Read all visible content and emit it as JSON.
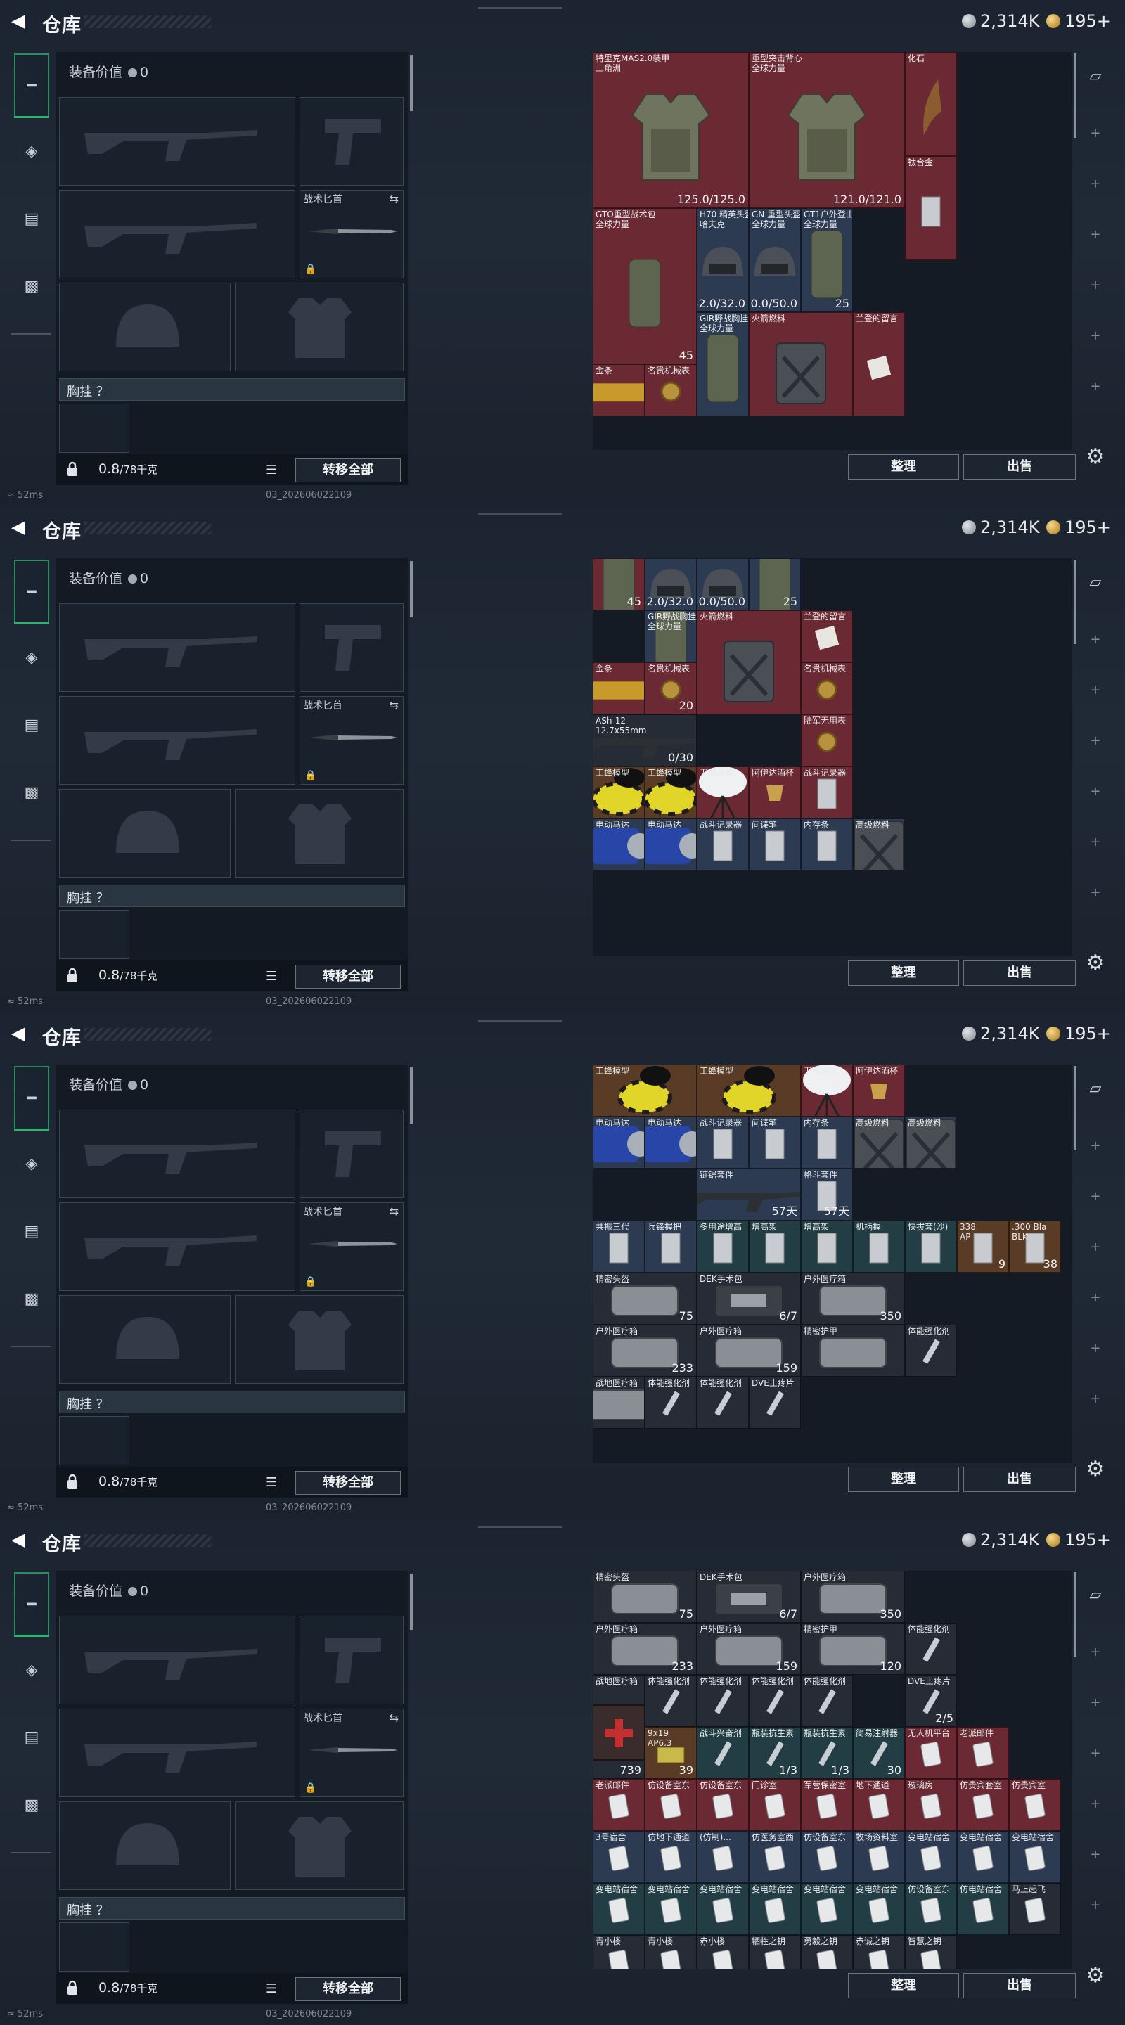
{
  "header": {
    "title": "仓库",
    "silver": "2,314K",
    "gold": "195+"
  },
  "loadout": {
    "equipment_value_label": "装备价值",
    "equipment_value": "0",
    "knife_label": "战术匕首",
    "chest_label": "胸挂 ？",
    "weight": "0.8",
    "weight_cap": "/78千克",
    "transfer_all": "转移全部"
  },
  "status": {
    "ping": "52ms",
    "build": "03_202606022109"
  },
  "stash": {
    "sort_label": "整理",
    "sell_label": "出售"
  },
  "frames": [
    {
      "items": [
        {
          "name": "特里克MAS2.0装甲",
          "sub": "三角洲",
          "value": "125.0/125.0",
          "color": "red",
          "art": "vest"
        },
        {
          "name": "重型突击背心",
          "sub": "全球力量",
          "value": "121.0/121.0",
          "color": "red",
          "art": "vest"
        },
        {
          "name": "化石",
          "sub": "",
          "value": "",
          "color": "red",
          "art": "claw"
        },
        {
          "name": "钛合金",
          "sub": "",
          "value": "",
          "color": "red",
          "art": "bar"
        },
        {
          "name": "GTO重型战术包",
          "sub": "全球力量",
          "value": "45",
          "color": "red",
          "art": "pack"
        },
        {
          "name": "H70 精英头盔",
          "sub": "哈夫克",
          "value": "32.0/32.0",
          "color": "blue",
          "art": "helmet"
        },
        {
          "name": "GN 重型头盔",
          "sub": "全球力量",
          "value": "50.0/50.0",
          "color": "blue",
          "art": "helmet"
        },
        {
          "name": "GT1户外登山包",
          "sub": "全球力量",
          "value": "25",
          "color": "blue",
          "art": "pack"
        },
        {
          "name": "GIR野战胸挂",
          "sub": "全球力量",
          "value": "",
          "color": "blue",
          "art": "pack"
        },
        {
          "name": "火箭燃料",
          "sub": "",
          "value": "",
          "color": "red",
          "art": "can"
        },
        {
          "name": "兰登的留言",
          "sub": "",
          "value": "",
          "color": "red",
          "art": "note"
        },
        {
          "name": "金条",
          "sub": "",
          "value": "",
          "color": "red",
          "art": "gold"
        },
        {
          "name": "名贵机械表",
          "sub": "",
          "value": "",
          "color": "red",
          "art": "watch"
        }
      ]
    },
    {
      "items": [
        {
          "name": "",
          "sub": "",
          "value": "45",
          "color": "red",
          "art": "pack"
        },
        {
          "name": "",
          "sub": "",
          "value": "32.0/32.0",
          "color": "blue",
          "art": "helmet"
        },
        {
          "name": "",
          "sub": "",
          "value": "50.0/50.0",
          "color": "blue",
          "art": "helmet"
        },
        {
          "name": "",
          "sub": "",
          "value": "25",
          "color": "blue",
          "art": "pack"
        },
        {
          "name": "GIR野战胸挂",
          "sub": "全球力量",
          "value": "",
          "color": "blue",
          "art": "pack"
        },
        {
          "name": "火箭燃料",
          "sub": "",
          "value": "",
          "color": "red",
          "art": "can"
        },
        {
          "name": "兰登的留言",
          "sub": "",
          "value": "",
          "color": "red",
          "art": "note"
        },
        {
          "name": "金条",
          "sub": "",
          "value": "",
          "color": "red",
          "art": "gold"
        },
        {
          "name": "名贵机械表",
          "sub": "",
          "value": "20",
          "color": "red",
          "art": "watch"
        },
        {
          "name": "ASh-12",
          "sub": "12.7x55mm",
          "value": "0/30",
          "color": "dark",
          "art": "rifle"
        },
        {
          "name": "名贵机械表",
          "sub": "",
          "value": "",
          "color": "red",
          "art": "watch"
        },
        {
          "name": "陆军无用表",
          "sub": "",
          "value": "",
          "color": "red",
          "art": "watch"
        },
        {
          "name": "工蜂模型",
          "sub": "",
          "value": "",
          "color": "brown",
          "art": "bee"
        },
        {
          "name": "工蜂模型",
          "sub": "",
          "value": "",
          "color": "brown",
          "art": "bee"
        },
        {
          "name": "卫星通信",
          "sub": "",
          "value": "",
          "color": "red",
          "art": "dish"
        },
        {
          "name": "阿伊达酒杯",
          "sub": "",
          "value": "",
          "color": "red",
          "art": "cup"
        },
        {
          "name": "战斗记录器",
          "sub": "",
          "value": "",
          "color": "red",
          "art": "bar"
        },
        {
          "name": "电动马达",
          "sub": "",
          "value": "",
          "color": "blue",
          "art": "motor"
        },
        {
          "name": "电动马达",
          "sub": "",
          "value": "",
          "color": "blue",
          "art": "motor"
        },
        {
          "name": "战斗记录器",
          "sub": "",
          "value": "",
          "color": "blue",
          "art": "bar"
        },
        {
          "name": "间谍笔",
          "sub": "",
          "value": "",
          "color": "blue",
          "art": "bar"
        },
        {
          "name": "内存条",
          "sub": "",
          "value": "",
          "color": "blue",
          "art": "bar"
        },
        {
          "name": "高级燃料",
          "sub": "",
          "value": "",
          "color": "blue",
          "art": "can"
        }
      ]
    },
    {
      "items": [
        {
          "name": "工蜂模型",
          "sub": "",
          "value": "",
          "color": "brown",
          "art": "bee"
        },
        {
          "name": "工蜂模型",
          "sub": "",
          "value": "",
          "color": "brown",
          "art": "bee"
        },
        {
          "name": "卫星通信",
          "sub": "",
          "value": "",
          "color": "red",
          "art": "dish"
        },
        {
          "name": "阿伊达酒杯",
          "sub": "",
          "value": "",
          "color": "red",
          "art": "cup"
        },
        {
          "name": "战斗记录器",
          "sub": "",
          "value": "",
          "color": "red",
          "art": "bar"
        },
        {
          "name": "电动马达",
          "sub": "",
          "value": "",
          "color": "blue",
          "art": "motor"
        },
        {
          "name": "电动马达",
          "sub": "",
          "value": "",
          "color": "blue",
          "art": "motor"
        },
        {
          "name": "战斗记录器",
          "sub": "",
          "value": "",
          "color": "blue",
          "art": "bar"
        },
        {
          "name": "间谍笔",
          "sub": "",
          "value": "",
          "color": "blue",
          "art": "bar"
        },
        {
          "name": "内存条",
          "sub": "",
          "value": "",
          "color": "blue",
          "art": "bar"
        },
        {
          "name": "高级燃料",
          "sub": "",
          "value": "",
          "color": "blue",
          "art": "can"
        },
        {
          "name": "高级燃料",
          "sub": "",
          "value": "",
          "color": "blue",
          "art": "can"
        },
        {
          "name": "链锯套件",
          "sub": "",
          "value": "57天",
          "color": "blue",
          "art": "rifle"
        },
        {
          "name": "格斗套件",
          "sub": "",
          "value": "57天",
          "color": "blue",
          "art": "bar"
        },
        {
          "name": "共振三代",
          "sub": "",
          "value": "",
          "color": "blue",
          "art": "bar"
        },
        {
          "name": "兵锋握把",
          "sub": "",
          "value": "",
          "color": "blue",
          "art": "bar"
        },
        {
          "name": "多用途增高",
          "sub": "",
          "value": "",
          "color": "teal",
          "art": "bar"
        },
        {
          "name": "增高架",
          "sub": "",
          "value": "",
          "color": "teal",
          "art": "bar"
        },
        {
          "name": "增高架",
          "sub": "",
          "value": "",
          "color": "teal",
          "art": "bar"
        },
        {
          "name": "机柄握",
          "sub": "",
          "value": "",
          "color": "teal",
          "art": "bar"
        },
        {
          "name": "快拔套(沙)",
          "sub": "",
          "value": "",
          "color": "teal",
          "art": "bar"
        },
        {
          "name": "338",
          "sub": "AP",
          "value": "9",
          "color": "brown",
          "art": "bar"
        },
        {
          "name": ".300 Bla",
          "sub": "BLK",
          "value": "38",
          "color": "brown",
          "art": "bar"
        },
        {
          "name": "精密头盔",
          "sub": "",
          "value": "75",
          "color": "dark",
          "art": "bag"
        },
        {
          "name": "DEK手术包",
          "sub": "",
          "value": "6/7",
          "color": "dark",
          "art": "kit"
        },
        {
          "name": "户外医疗箱",
          "sub": "",
          "value": "350",
          "color": "dark",
          "art": "bag"
        },
        {
          "name": "户外医疗箱",
          "sub": "",
          "value": "233",
          "color": "dark",
          "art": "bag"
        },
        {
          "name": "户外医疗箱",
          "sub": "",
          "value": "159",
          "color": "dark",
          "art": "bag"
        },
        {
          "name": "精密护甲",
          "sub": "",
          "value": "",
          "color": "dark",
          "art": "bag"
        },
        {
          "name": "体能强化剂",
          "sub": "",
          "value": "",
          "color": "dark",
          "art": "syringe"
        },
        {
          "name": "战地医疗箱",
          "sub": "",
          "value": "",
          "color": "dark",
          "art": "bag"
        },
        {
          "name": "体能强化剂",
          "sub": "",
          "value": "",
          "color": "dark",
          "art": "syringe"
        },
        {
          "name": "体能强化剂",
          "sub": "",
          "value": "",
          "color": "dark",
          "art": "syringe"
        },
        {
          "name": "DVE止疼片",
          "sub": "",
          "value": "",
          "color": "dark",
          "art": "syringe"
        }
      ]
    },
    {
      "items": [
        {
          "name": "精密头盔",
          "sub": "",
          "value": "75",
          "color": "dark",
          "art": "bag"
        },
        {
          "name": "DEK手术包",
          "sub": "",
          "value": "6/7",
          "color": "dark",
          "art": "kit"
        },
        {
          "name": "户外医疗箱",
          "sub": "",
          "value": "350",
          "color": "dark",
          "art": "bag"
        },
        {
          "name": "户外医疗箱",
          "sub": "",
          "value": "233",
          "color": "dark",
          "art": "bag"
        },
        {
          "name": "户外医疗箱",
          "sub": "",
          "value": "159",
          "color": "dark",
          "art": "bag"
        },
        {
          "name": "精密护甲",
          "sub": "",
          "value": "120",
          "color": "dark",
          "art": "bag"
        },
        {
          "name": "体能强化剂",
          "sub": "",
          "value": "",
          "color": "dark",
          "art": "syringe"
        },
        {
          "name": "战地医疗箱",
          "sub": "",
          "value": "739",
          "color": "dark",
          "art": "medkit"
        },
        {
          "name": "体能强化剂",
          "sub": "",
          "value": "",
          "color": "dark",
          "art": "syringe"
        },
        {
          "name": "体能强化剂",
          "sub": "",
          "value": "",
          "color": "dark",
          "art": "syringe"
        },
        {
          "name": "体能强化剂",
          "sub": "",
          "value": "",
          "color": "dark",
          "art": "syringe"
        },
        {
          "name": "体能强化剂",
          "sub": "",
          "value": "",
          "color": "dark",
          "art": "syringe"
        },
        {
          "name": "DVE止疼片",
          "sub": "",
          "value": "2/5",
          "color": "dark",
          "art": "syringe"
        },
        {
          "name": "9x19",
          "sub": "AP6.3",
          "value": "39",
          "color": "brown",
          "art": "ammo"
        },
        {
          "name": "战斗兴奋剂",
          "sub": "",
          "value": "",
          "color": "teal",
          "art": "syringe"
        },
        {
          "name": "瓶装抗生素",
          "sub": "",
          "value": "1/3",
          "color": "teal",
          "art": "syringe"
        },
        {
          "name": "瓶装抗生素",
          "sub": "",
          "value": "1/3",
          "color": "teal",
          "art": "syringe"
        },
        {
          "name": "简易注射器",
          "sub": "",
          "value": "30",
          "color": "teal",
          "art": "syringe"
        },
        {
          "name": "无人机平台",
          "sub": "",
          "value": "",
          "color": "red",
          "art": "card"
        },
        {
          "name": "老派邮件",
          "sub": "",
          "value": "",
          "color": "red",
          "art": "card"
        },
        {
          "name": "老派邮件",
          "sub": "",
          "value": "",
          "color": "red",
          "art": "card"
        },
        {
          "name": "仿设备室东",
          "sub": "",
          "value": "",
          "color": "red",
          "art": "card"
        },
        {
          "name": "仿设备室东",
          "sub": "",
          "value": "",
          "color": "red",
          "art": "card"
        },
        {
          "name": "门诊室",
          "sub": "",
          "value": "",
          "color": "red",
          "art": "card"
        },
        {
          "name": "军营保密室",
          "sub": "",
          "value": "",
          "color": "red",
          "art": "card"
        },
        {
          "name": "地下通道",
          "sub": "",
          "value": "",
          "color": "red",
          "art": "card"
        },
        {
          "name": "玻璃房",
          "sub": "",
          "value": "",
          "color": "red",
          "art": "card"
        },
        {
          "name": "仿贵宾套室",
          "sub": "",
          "value": "",
          "color": "red",
          "art": "card"
        },
        {
          "name": "仿贵宾室",
          "sub": "",
          "value": "",
          "color": "red",
          "art": "card"
        },
        {
          "name": "3号宿舍",
          "sub": "",
          "value": "",
          "color": "blue",
          "art": "card"
        },
        {
          "name": "仿地下通道",
          "sub": "",
          "value": "",
          "color": "blue",
          "art": "card"
        },
        {
          "name": "(仿制)...",
          "sub": "",
          "value": "",
          "color": "blue",
          "art": "card"
        },
        {
          "name": "仿医务室西",
          "sub": "",
          "value": "",
          "color": "blue",
          "art": "card"
        },
        {
          "name": "仿设备室东",
          "sub": "",
          "value": "",
          "color": "blue",
          "art": "card"
        },
        {
          "name": "牧场资料室",
          "sub": "",
          "value": "",
          "color": "blue",
          "art": "card"
        },
        {
          "name": "变电站宿舍",
          "sub": "",
          "value": "",
          "color": "blue",
          "art": "card"
        },
        {
          "name": "变电站宿舍",
          "sub": "",
          "value": "",
          "color": "blue",
          "art": "card"
        },
        {
          "name": "变电站宿舍",
          "sub": "",
          "value": "",
          "color": "blue",
          "art": "card"
        },
        {
          "name": "变电站宿舍",
          "sub": "",
          "value": "",
          "color": "teal",
          "art": "card"
        },
        {
          "name": "变电站宿舍",
          "sub": "",
          "value": "",
          "color": "teal",
          "art": "card"
        },
        {
          "name": "变电站宿舍",
          "sub": "",
          "value": "",
          "color": "teal",
          "art": "card"
        },
        {
          "name": "变电站宿舍",
          "sub": "",
          "value": "",
          "color": "teal",
          "art": "card"
        },
        {
          "name": "变电站宿舍",
          "sub": "",
          "value": "",
          "color": "teal",
          "art": "card"
        },
        {
          "name": "变电站宿舍",
          "sub": "",
          "value": "",
          "color": "teal",
          "art": "card"
        },
        {
          "name": "仿设备室东",
          "sub": "",
          "value": "",
          "color": "teal",
          "art": "card"
        },
        {
          "name": "仿电站宿舍",
          "sub": "",
          "value": "",
          "color": "teal",
          "art": "card"
        },
        {
          "name": "马上起飞",
          "sub": "",
          "value": "",
          "color": "dark",
          "art": "card"
        },
        {
          "name": "青小楼",
          "sub": "",
          "value": "",
          "color": "dark",
          "art": "card"
        },
        {
          "name": "青小楼",
          "sub": "",
          "value": "",
          "color": "dark",
          "art": "card"
        },
        {
          "name": "赤小楼",
          "sub": "",
          "value": "",
          "color": "dark",
          "art": "card"
        },
        {
          "name": "牺牲之钥",
          "sub": "",
          "value": "",
          "color": "dark",
          "art": "card"
        },
        {
          "name": "勇毅之钥",
          "sub": "",
          "value": "",
          "color": "dark",
          "art": "card"
        },
        {
          "name": "赤诚之钥",
          "sub": "",
          "value": "",
          "color": "dark",
          "art": "card"
        },
        {
          "name": "智慧之钥",
          "sub": "",
          "value": "",
          "color": "dark",
          "art": "card"
        }
      ]
    }
  ]
}
